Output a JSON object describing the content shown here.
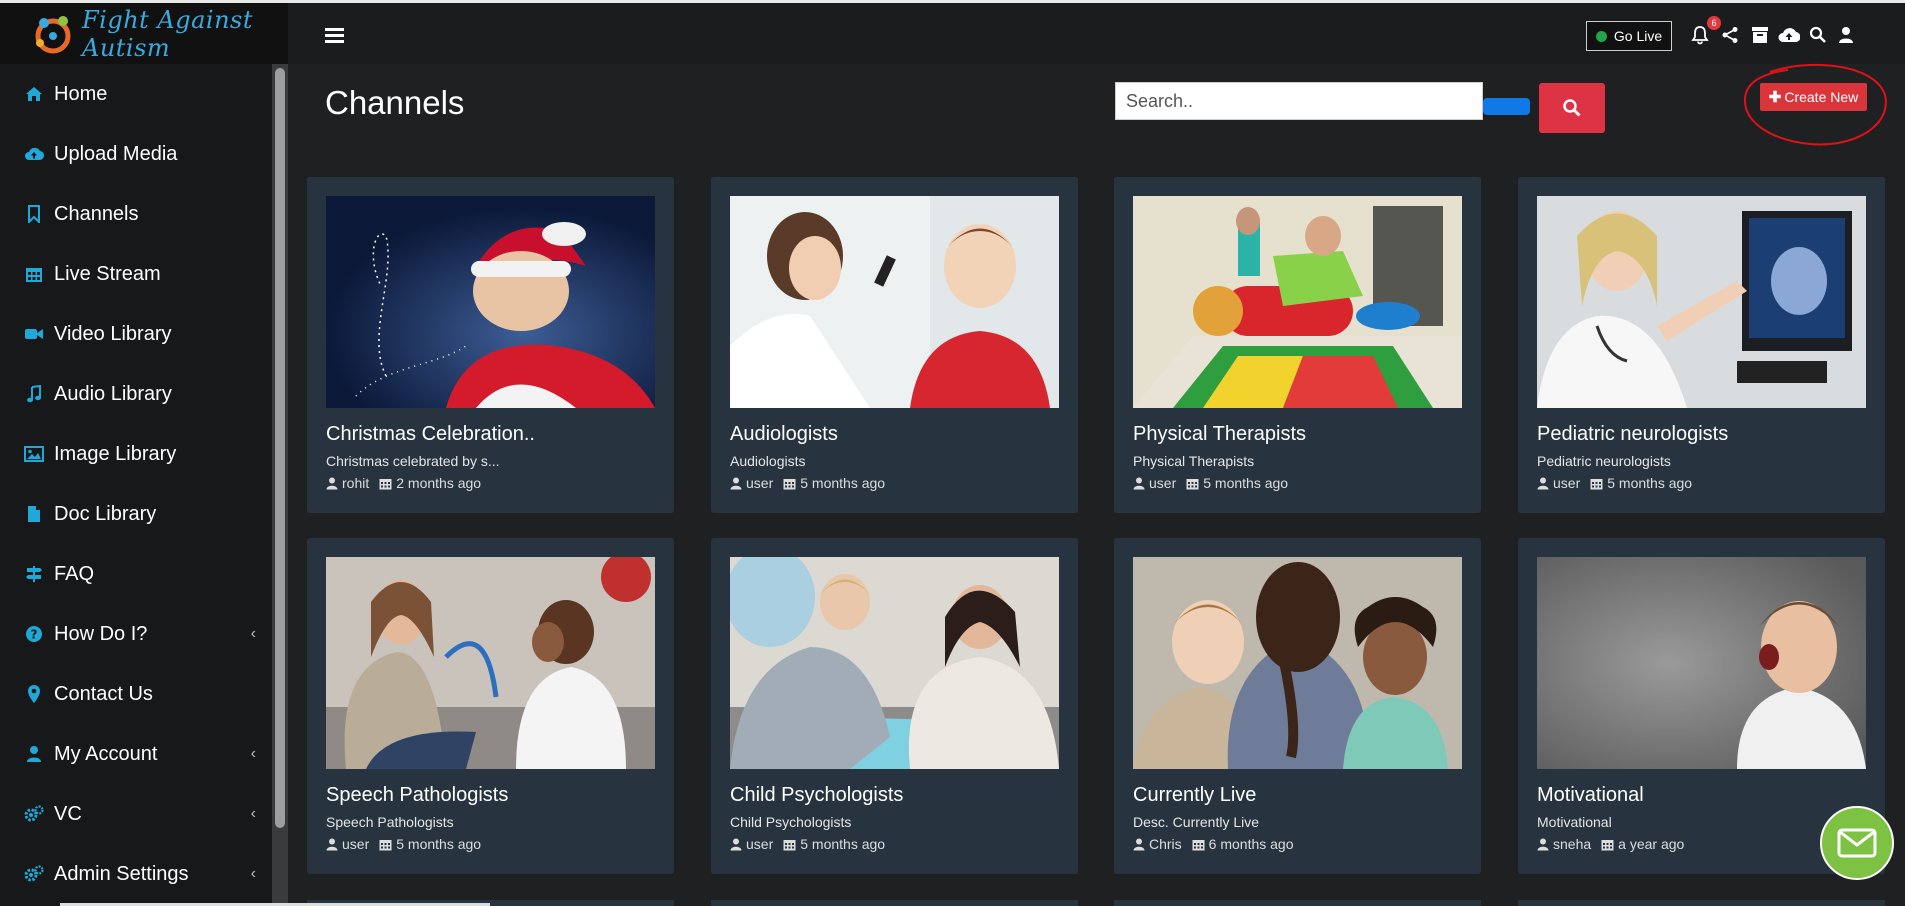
{
  "brand": {
    "name": "Fight Against Autism"
  },
  "sidebar": {
    "items": [
      {
        "label": "Home",
        "icon": "home-icon",
        "has_submenu": false
      },
      {
        "label": "Upload Media",
        "icon": "cloud-upload-icon",
        "has_submenu": false
      },
      {
        "label": "Channels",
        "icon": "bookmark-icon",
        "has_submenu": false
      },
      {
        "label": "Live Stream",
        "icon": "calendar-icon",
        "has_submenu": false
      },
      {
        "label": "Video Library",
        "icon": "video-camera-icon",
        "has_submenu": false
      },
      {
        "label": "Audio Library",
        "icon": "music-note-icon",
        "has_submenu": false
      },
      {
        "label": "Image Library",
        "icon": "image-icon",
        "has_submenu": false
      },
      {
        "label": "Doc Library",
        "icon": "document-icon",
        "has_submenu": false
      },
      {
        "label": "FAQ",
        "icon": "signpost-icon",
        "has_submenu": false
      },
      {
        "label": "How Do I?",
        "icon": "question-circle-icon",
        "has_submenu": true
      },
      {
        "label": "Contact Us",
        "icon": "map-marker-icon",
        "has_submenu": false
      },
      {
        "label": "My Account",
        "icon": "user-icon",
        "has_submenu": true
      },
      {
        "label": "VC",
        "icon": "gears-icon",
        "has_submenu": true
      },
      {
        "label": "Admin Settings",
        "icon": "gears-icon",
        "has_submenu": true
      }
    ]
  },
  "topbar": {
    "go_live_label": "Go Live",
    "notification_count": "6",
    "icons": [
      "bell-icon",
      "share-icon",
      "archive-icon",
      "cloud-upload-icon",
      "search-icon",
      "user-icon"
    ]
  },
  "main": {
    "title": "Channels",
    "search_placeholder": "Search..",
    "create_label": "Create New"
  },
  "channels": [
    {
      "name": "Christmas Celebration..",
      "desc": "Christmas celebrated by s...",
      "user": "rohit",
      "time": "2 months ago"
    },
    {
      "name": "Audiologists",
      "desc": "Audiologists",
      "user": "user",
      "time": "5 months ago"
    },
    {
      "name": "Physical Therapists",
      "desc": "Physical Therapists",
      "user": "user",
      "time": "5 months ago"
    },
    {
      "name": "Pediatric neurologists",
      "desc": "Pediatric neurologists",
      "user": "user",
      "time": "5 months ago"
    },
    {
      "name": "Speech Pathologists",
      "desc": "Speech Pathologists",
      "user": "user",
      "time": "5 months ago"
    },
    {
      "name": "Child Psychologists",
      "desc": "Child Psychologists",
      "user": "user",
      "time": "5 months ago"
    },
    {
      "name": "Currently Live",
      "desc": "Desc. Currently Live",
      "user": "Chris",
      "time": "6 months ago"
    },
    {
      "name": "Motivational",
      "desc": "Motivational",
      "user": "sneha",
      "time": "a year ago"
    }
  ],
  "colors": {
    "accent": "#1fa8d8",
    "danger": "#dd3344",
    "card": "#27343f",
    "fab": "#7dc242"
  }
}
